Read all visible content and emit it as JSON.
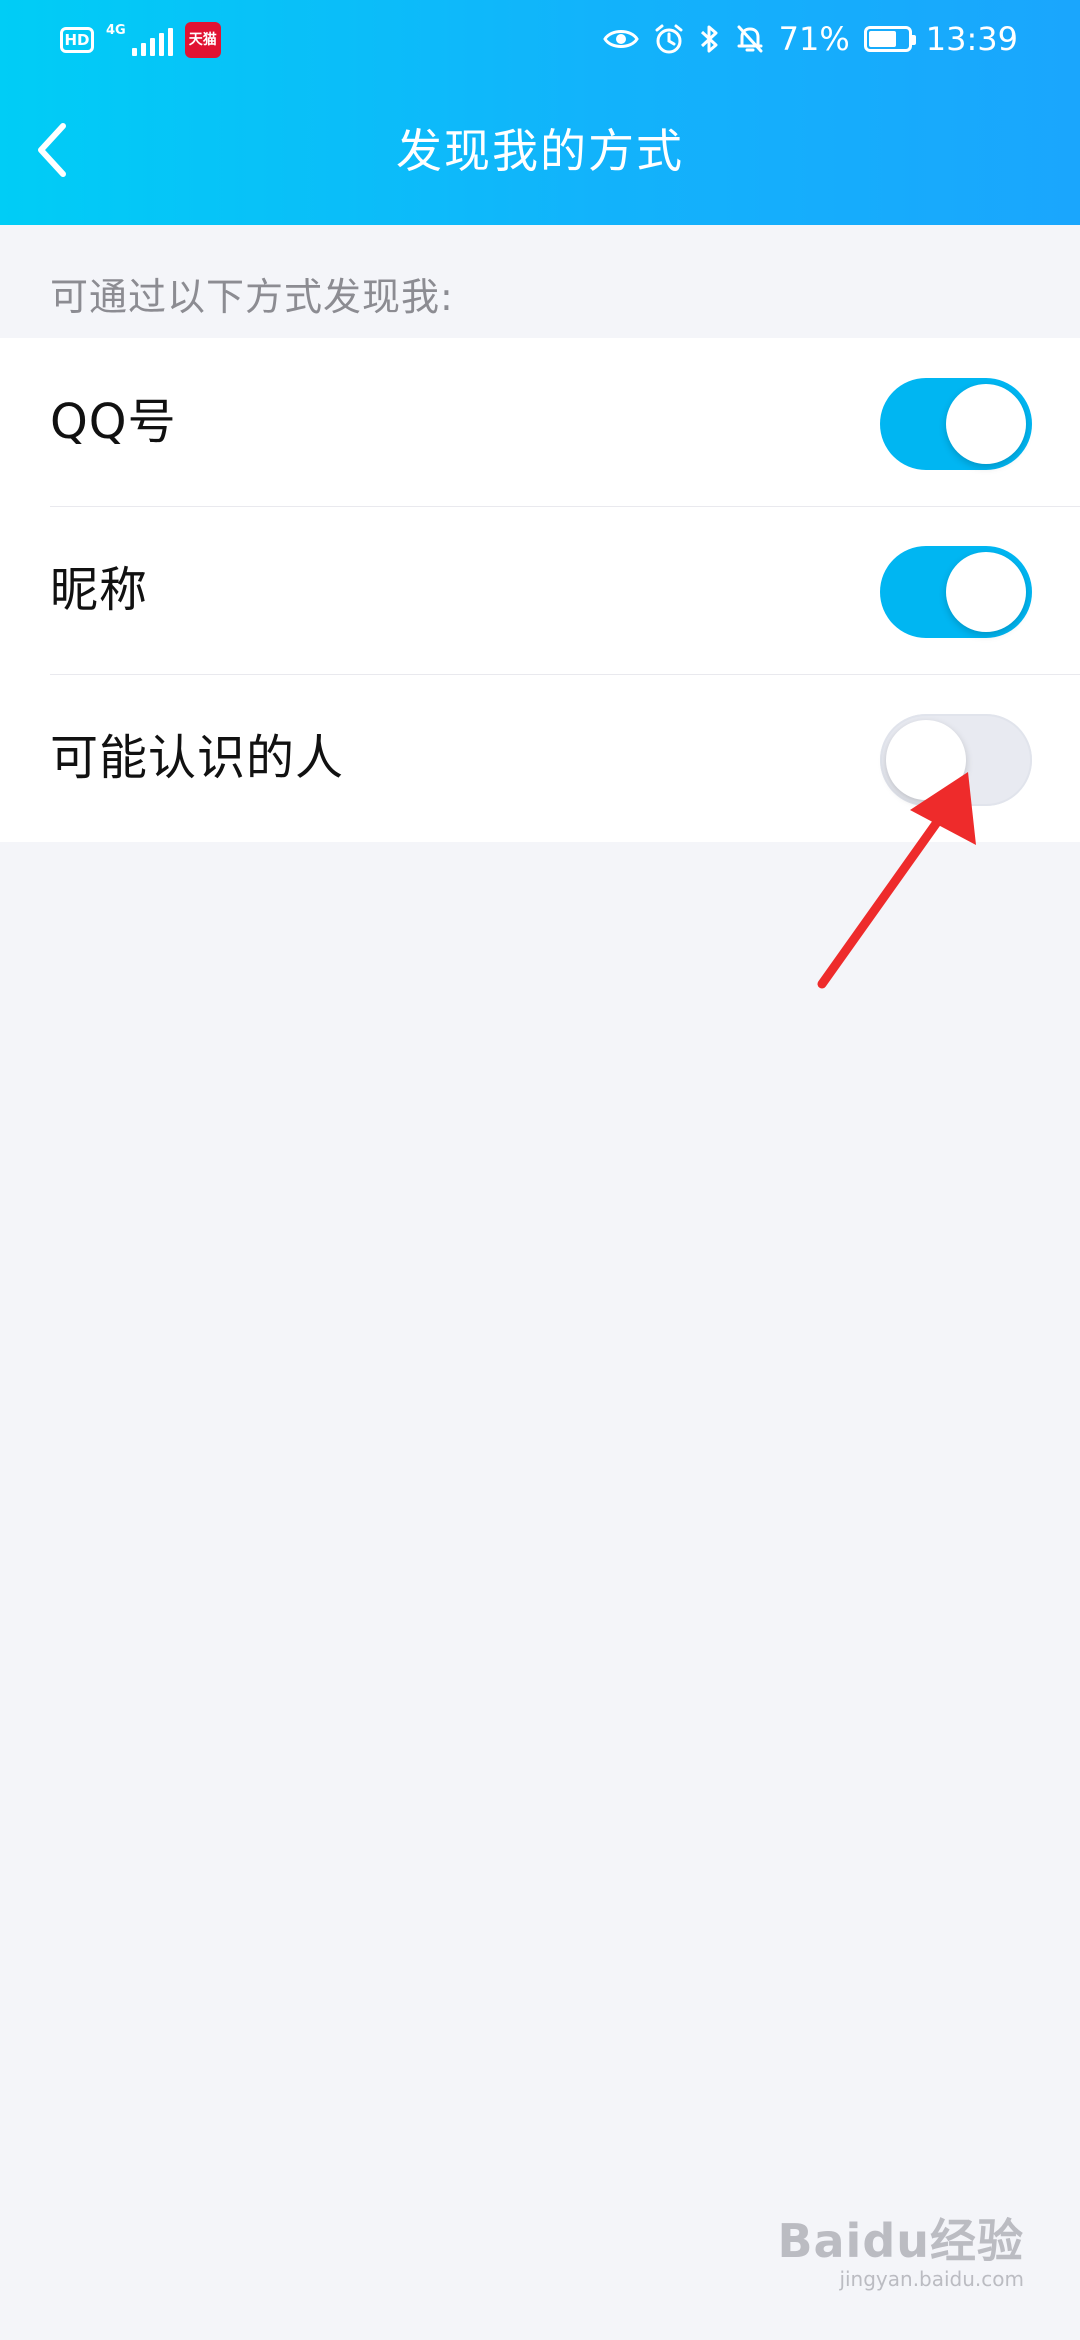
{
  "status_bar": {
    "hd_label": "HD",
    "network_label": "4G",
    "tmall_label": "天猫",
    "battery_percent": "71%",
    "battery_level": 0.71,
    "time": "13:39",
    "icons": [
      "eye-icon",
      "alarm-icon",
      "bluetooth-icon",
      "bell-off-icon",
      "battery-icon"
    ]
  },
  "header": {
    "title": "发现我的方式",
    "back_icon": "chevron-left-icon"
  },
  "section": {
    "caption": "可通过以下方式发现我:"
  },
  "settings": [
    {
      "label": "QQ号",
      "enabled": true
    },
    {
      "label": "昵称",
      "enabled": true
    },
    {
      "label": "可能认识的人",
      "enabled": false
    }
  ],
  "watermark": {
    "main": "Baidu经验",
    "sub": "jingyan.baidu.com"
  },
  "colors": {
    "header_gradient_start": "#00cdf6",
    "header_gradient_end": "#1aa6fd",
    "toggle_on": "#00b6f2",
    "toggle_off": "#e8eaf1",
    "page_background": "#f4f5f9",
    "annotation_arrow": "#ee2b2b"
  }
}
